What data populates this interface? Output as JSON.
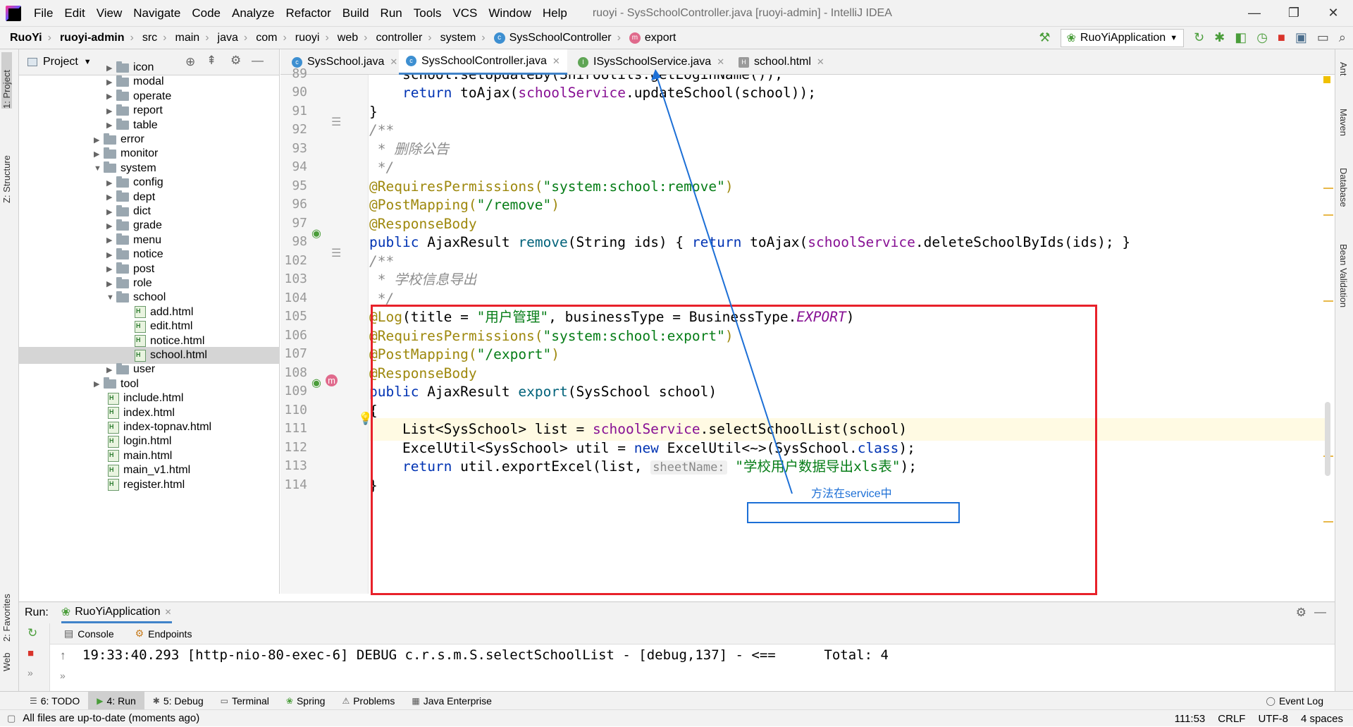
{
  "menubar": {
    "items": [
      "File",
      "Edit",
      "View",
      "Navigate",
      "Code",
      "Analyze",
      "Refactor",
      "Build",
      "Run",
      "Tools",
      "VCS",
      "Window",
      "Help"
    ],
    "title": "ruoyi - SysSchoolController.java [ruoyi-admin] - IntelliJ IDEA"
  },
  "breadcrumb": [
    "RuoYi",
    "ruoyi-admin",
    "src",
    "main",
    "java",
    "com",
    "ruoyi",
    "web",
    "controller",
    "system",
    "SysSchoolController",
    "export"
  ],
  "toolbar": {
    "run_config": "RuoYiApplication"
  },
  "left_strip": {
    "project": "1: Project",
    "structure": "Z: Structure",
    "favorites": "2: Favorites",
    "web": "Web"
  },
  "right_strip": {
    "ant": "Ant",
    "maven": "Maven",
    "database": "Database",
    "bean_validation": "Bean Validation"
  },
  "project": {
    "title": "Project",
    "tree": [
      {
        "label": "icon",
        "type": "folder",
        "arrow": "▶"
      },
      {
        "label": "modal",
        "type": "folder",
        "arrow": "▶"
      },
      {
        "label": "operate",
        "type": "folder",
        "arrow": "▶"
      },
      {
        "label": "report",
        "type": "folder",
        "arrow": "▶"
      },
      {
        "label": "table",
        "type": "folder",
        "arrow": "▶"
      },
      {
        "label": "error",
        "type": "folder",
        "arrow": "▶"
      },
      {
        "label": "monitor",
        "type": "folder",
        "arrow": "▶"
      },
      {
        "label": "system",
        "type": "folder",
        "arrow": "▼"
      },
      {
        "label": "config",
        "type": "folder",
        "arrow": "▶"
      },
      {
        "label": "dept",
        "type": "folder",
        "arrow": "▶"
      },
      {
        "label": "dict",
        "type": "folder",
        "arrow": "▶"
      },
      {
        "label": "grade",
        "type": "folder",
        "arrow": "▶"
      },
      {
        "label": "menu",
        "type": "folder",
        "arrow": "▶"
      },
      {
        "label": "notice",
        "type": "folder",
        "arrow": "▶"
      },
      {
        "label": "post",
        "type": "folder",
        "arrow": "▶"
      },
      {
        "label": "role",
        "type": "folder",
        "arrow": "▶"
      },
      {
        "label": "school",
        "type": "folder",
        "arrow": "▼"
      },
      {
        "label": "add.html",
        "type": "html",
        "arrow": ""
      },
      {
        "label": "edit.html",
        "type": "html",
        "arrow": ""
      },
      {
        "label": "notice.html",
        "type": "html",
        "arrow": ""
      },
      {
        "label": "school.html",
        "type": "html",
        "arrow": ""
      },
      {
        "label": "user",
        "type": "folder",
        "arrow": "▶"
      },
      {
        "label": "tool",
        "type": "folder",
        "arrow": "▶"
      },
      {
        "label": "include.html",
        "type": "html",
        "arrow": ""
      },
      {
        "label": "index.html",
        "type": "html",
        "arrow": ""
      },
      {
        "label": "index-topnav.html",
        "type": "html",
        "arrow": ""
      },
      {
        "label": "login.html",
        "type": "html",
        "arrow": ""
      },
      {
        "label": "main.html",
        "type": "html",
        "arrow": ""
      },
      {
        "label": "main_v1.html",
        "type": "html",
        "arrow": ""
      },
      {
        "label": "register.html",
        "type": "html",
        "arrow": ""
      }
    ]
  },
  "tabs": [
    {
      "label": "SysSchool.java",
      "icon": "c"
    },
    {
      "label": "SysSchoolController.java",
      "icon": "c"
    },
    {
      "label": "ISysSchoolService.java",
      "icon": "i"
    },
    {
      "label": "school.html",
      "icon": "h"
    }
  ],
  "line_numbers": [
    "89",
    "90",
    "91",
    "92",
    "93",
    "94",
    "95",
    "96",
    "97",
    "98",
    "102",
    "103",
    "104",
    "105",
    "106",
    "107",
    "108",
    "109",
    "110",
    "111",
    "112",
    "113",
    "114"
  ],
  "code": {
    "l89": "school.setUpdateBy(ShiroUtils.getLoginName());",
    "l90_kw": "return",
    "l90_a": " toAjax(",
    "l90_f": "schoolService",
    "l90_b": ".updateSchool(school));",
    "l91": "}",
    "l92": "/**",
    "l93": " * 删除公告",
    "l94": " */",
    "l95_a": "@RequiresPermissions(",
    "l95_s": "\"system:school:remove\"",
    "l95_b": ")",
    "l96_a": "@PostMapping(",
    "l96_s": "\"/remove\"",
    "l96_b": ")",
    "l97": "@ResponseBody",
    "l98_kw": "public",
    "l98_a": " AjaxResult ",
    "l98_m": "remove",
    "l98_b": "(String ids) { ",
    "l98_kw2": "return",
    "l98_c": " toAjax(",
    "l98_f": "schoolService",
    "l98_d": ".deleteSchoolByIds(ids); }",
    "l102": "/**",
    "l103": " * 学校信息导出",
    "l104": " */",
    "l105_a": "@Log",
    "l105_b": "(title = ",
    "l105_s": "\"用户管理\"",
    "l105_c": ", businessType = BusinessType.",
    "l105_d": "EXPORT",
    "l105_e": ")",
    "l106_a": "@RequiresPermissions(",
    "l106_s": "\"system:school:export\"",
    "l106_b": ")",
    "l107_a": "@PostMapping(",
    "l107_s": "\"/export\"",
    "l107_b": ")",
    "l108": "@ResponseBody",
    "l109_kw": "public",
    "l109_a": " AjaxResult ",
    "l109_m": "export",
    "l109_b": "(SysSchool school)",
    "l110": "{",
    "l111_a": "List<SysSchool> list = ",
    "l111_f": "schoolService",
    "l111_b": ".selectSchoolList(school)",
    "l112_a": "ExcelUtil<SysSchool> util = ",
    "l112_kw": "new",
    "l112_b": " ExcelUtil<~>(SysSchool.",
    "l112_kw2": "class",
    "l112_c": ");",
    "l113_kw": "return",
    "l113_a": " util.exportExcel(list, ",
    "l113_hint": "sheetName:",
    "l113_s": " \"学校用户数据导出xls表\"",
    "l113_b": ");",
    "l114": "}"
  },
  "annotation": {
    "text": "方法在service中",
    "red_color": "#e8212a",
    "blue_color": "#1c6fd6"
  },
  "run": {
    "label": "Run:",
    "config": "RuoYiApplication",
    "console_tab": "Console",
    "endpoints_tab": "Endpoints",
    "log": "19:33:40.293 [http-nio-80-exec-6] DEBUG c.r.s.m.S.selectSchoolList - [debug,137] - <==      Total: 4"
  },
  "bottom_tabs": [
    {
      "label": "6: TODO"
    },
    {
      "label": "4: Run"
    },
    {
      "label": "5: Debug"
    },
    {
      "label": "Terminal"
    },
    {
      "label": "Spring"
    },
    {
      "label": "Problems"
    },
    {
      "label": "Java Enterprise"
    }
  ],
  "event_log": "Event Log",
  "status": {
    "message": "All files are up-to-date (moments ago)",
    "position": "111:53",
    "line_sep": "CRLF",
    "encoding": "UTF-8",
    "indent": "4 spaces"
  }
}
